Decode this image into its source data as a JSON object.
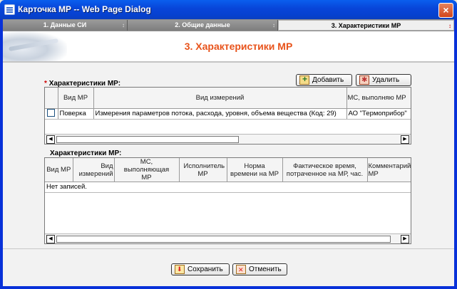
{
  "window": {
    "title": "Карточка МР -- Web Page Dialog",
    "close_label": "×"
  },
  "tabs": [
    {
      "label": "1. Данные СИ",
      "arrow": "↕"
    },
    {
      "label": "2. Общие данные",
      "arrow": "↕"
    },
    {
      "label": "3. Характеристики МР",
      "arrow": "↕"
    }
  ],
  "page_title": "3. Характеристики МР",
  "section1": {
    "required_mark": "*",
    "label": "Характеристики МР:",
    "add_label": "Добавить",
    "delete_label": "Удалить",
    "columns": [
      "Вид МР",
      "Вид измерений",
      "МС, выполняю МР"
    ],
    "rows": [
      {
        "vid_mr": "Поверка",
        "vid_izm": "Измерения параметров потока, расхода, уровня, объема вещества (Код: 29)",
        "ms": "АО \"Термоприбор\""
      }
    ]
  },
  "section2": {
    "label": "Характеристики МР:",
    "columns": [
      "Вид МР",
      "Вид измерений",
      "МС, выполняющая МР",
      "Исполнитель МР",
      "Норма времени на МР",
      "Фактическое время, потраченное на МР, час.",
      "Комментарий по МР"
    ],
    "empty_text": "Нет записей."
  },
  "scroll": {
    "left": "◀",
    "right": "▶"
  },
  "footer": {
    "save_label": "Сохранить",
    "cancel_label": "Отменить"
  }
}
